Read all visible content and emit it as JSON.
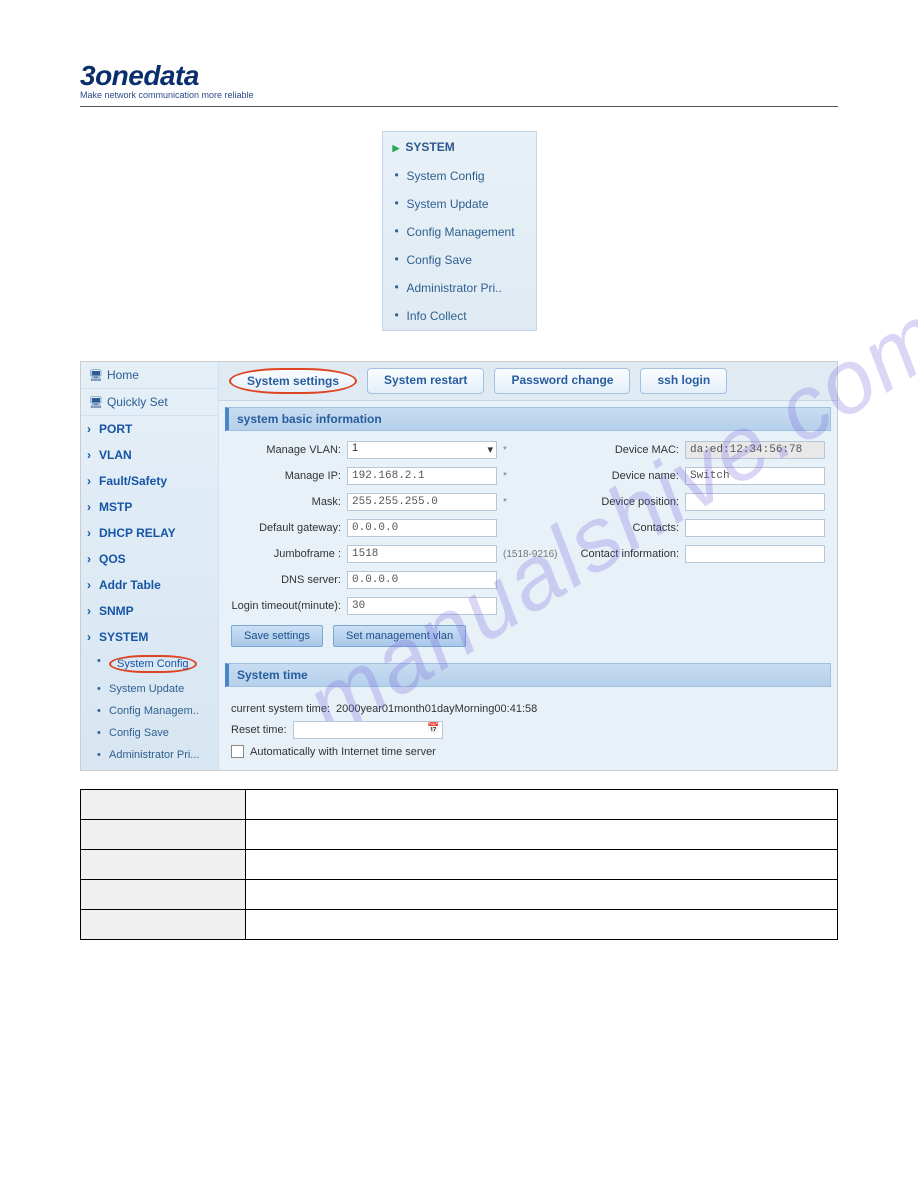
{
  "logo": {
    "brand": "3onedata",
    "tagline": "Make network communication more reliable"
  },
  "menu": {
    "title": "SYSTEM",
    "items": [
      "System Config",
      "System Update",
      "Config Management",
      "Config Save",
      "Administrator Pri..",
      "Info Collect"
    ]
  },
  "leftnav": {
    "top1": "Home",
    "top2": "Quickly Set",
    "cats": [
      "PORT",
      "VLAN",
      "Fault/Safety",
      "MSTP",
      "DHCP RELAY",
      "QOS",
      "Addr Table",
      "SNMP",
      "SYSTEM"
    ],
    "subs": [
      "System Config",
      "System Update",
      "Config Managem..",
      "Config Save",
      "Administrator Pri..."
    ]
  },
  "tabs": [
    "System settings",
    "System restart",
    "Password change",
    "ssh login"
  ],
  "sec1": "system basic information",
  "sec2": "System time",
  "form": {
    "vlan_lbl": "Manage VLAN:",
    "vlan_val": "1",
    "ip_lbl": "Manage IP:",
    "ip_val": "192.168.2.1",
    "mask_lbl": "Mask:",
    "mask_val": "255.255.255.0",
    "gw_lbl": "Default gateway:",
    "gw_val": "0.0.0.0",
    "jumbo_lbl": "Jumboframe :",
    "jumbo_val": "1518",
    "jumbo_hint": "(1518-9216)",
    "dns_lbl": "DNS server:",
    "dns_val": "0.0.0.0",
    "timeout_lbl": "Login timeout(minute):",
    "timeout_val": "30",
    "mac_lbl": "Device MAC:",
    "mac_val": "da:ed:12:34:56:78",
    "name_lbl": "Device name:",
    "name_val": "Switch",
    "pos_lbl": "Device position:",
    "pos_val": "",
    "contacts_lbl": "Contacts:",
    "contacts_val": "",
    "cinfo_lbl": "Contact information:",
    "cinfo_val": ""
  },
  "btns": {
    "save": "Save settings",
    "setvlan": "Set management vlan"
  },
  "time": {
    "cur_lbl": "current system time:",
    "cur_val": "2000year01month01dayMorning00:41:58",
    "reset_lbl": "Reset time:",
    "auto": "Automatically with Internet time server"
  },
  "watermark": "manualshive.com"
}
